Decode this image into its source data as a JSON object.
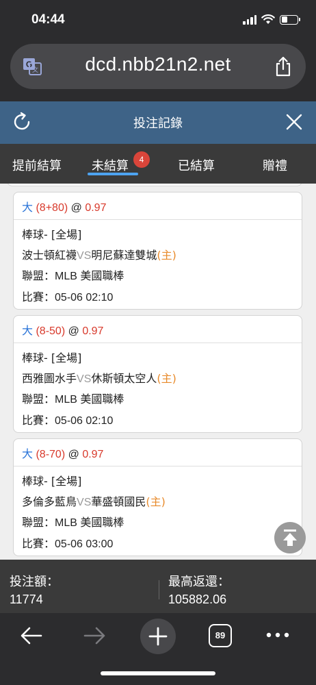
{
  "status": {
    "time": "04:44"
  },
  "browser": {
    "url": "dcd.nbb21n2.net",
    "tab_count": "89"
  },
  "header": {
    "title": "投注記錄"
  },
  "tabs": [
    {
      "label": "提前結算"
    },
    {
      "label": "未結算",
      "badge": "4"
    },
    {
      "label": "已結算"
    },
    {
      "label": "贈禮"
    }
  ],
  "bets": [
    {
      "pick": "大",
      "handicap": "(8+80)",
      "at": "@",
      "odds": "0.97",
      "sport_line": "棒球- [全場]",
      "team_away": "波士頓紅襪",
      "vs": "VS",
      "team_home": "明尼蘇達雙城",
      "home_tag": "(主)",
      "league_label": "聯盟：",
      "league": "MLB 美國職棒",
      "match_label": "比賽：",
      "match_time": "05-06 02:10"
    },
    {
      "pick": "大",
      "handicap": "(8-50)",
      "at": "@",
      "odds": "0.97",
      "sport_line": "棒球- [全場]",
      "team_away": "西雅圖水手",
      "vs": "VS",
      "team_home": "休斯頓太空人",
      "home_tag": "(主)",
      "league_label": "聯盟：",
      "league": "MLB 美國職棒",
      "match_label": "比賽：",
      "match_time": "05-06 02:10"
    },
    {
      "pick": "大",
      "handicap": "(8-70)",
      "at": "@",
      "odds": "0.97",
      "sport_line": "棒球- [全場]",
      "team_away": "多倫多藍鳥",
      "vs": "VS",
      "team_home": "華盛頓國民",
      "home_tag": "(主)",
      "league_label": "聯盟：",
      "league": "MLB 美國職棒",
      "match_label": "比賽：",
      "match_time": "05-06 03:00"
    }
  ],
  "summary": {
    "stake_label": "投注額：",
    "stake_value": "11774",
    "max_return_label": "最高返還：",
    "max_return_value": "105882.06"
  },
  "colors": {
    "header_bg": "#3e6387",
    "tab_underline": "#4da3f0",
    "badge": "#d9453a",
    "pick_blue": "#2a74d8",
    "odds_red": "#d8392b",
    "home_orange": "#e88a2a"
  }
}
